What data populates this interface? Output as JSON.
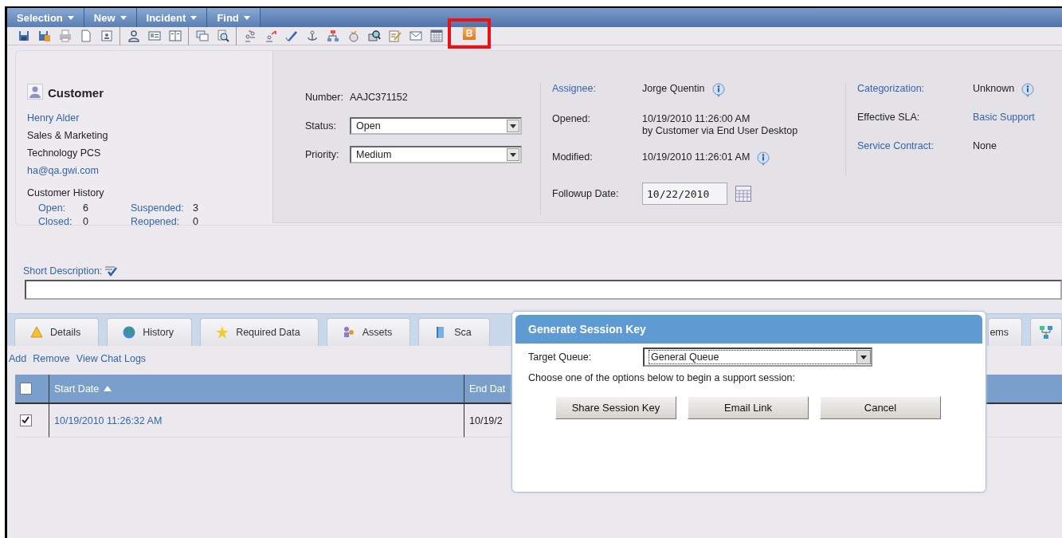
{
  "menu": [
    {
      "label": "Selection"
    },
    {
      "label": "New"
    },
    {
      "label": "Incident"
    },
    {
      "label": "Find"
    }
  ],
  "toolbar": {
    "groups": [
      [
        {
          "highlighted": false
        },
        {
          "highlighted": false
        },
        {
          "highlighted": false
        },
        {
          "highlighted": false
        },
        {
          "highlighted": false
        }
      ],
      [
        {
          "highlighted": false
        },
        {
          "highlighted": false
        },
        {
          "highlighted": false
        }
      ],
      [
        {
          "highlighted": false
        },
        {
          "highlighted": false
        }
      ],
      [
        {
          "highlighted": false
        },
        {
          "highlighted": false
        },
        {
          "highlighted": false
        },
        {
          "highlighted": false
        },
        {
          "highlighted": false
        },
        {
          "highlighted": false
        },
        {
          "highlighted": false
        },
        {
          "highlighted": false
        },
        {
          "highlighted": false
        },
        {
          "highlighted": false
        },
        {
          "highlighted": true,
          "label": "B"
        }
      ]
    ]
  },
  "customer": {
    "title": "Customer",
    "name": "Henry Alder",
    "department": "Sales & Marketing",
    "company": "Technology PCS",
    "email": "ha@qa.gwi.com",
    "history_title": "Customer History",
    "history": [
      {
        "label": "Open:",
        "value": "6"
      },
      {
        "label": "Suspended:",
        "value": "3"
      },
      {
        "label": "Closed:",
        "value": "0"
      },
      {
        "label": "Reopened:",
        "value": "0"
      }
    ]
  },
  "incident": {
    "number_label": "Number:",
    "number": "AAJC371152",
    "status_label": "Status:",
    "status": "Open",
    "priority_label": "Priority:",
    "priority": "Medium"
  },
  "details": [
    {
      "kind": "text",
      "label": "Assignee:",
      "label_link": true,
      "lines": [
        "Jorge Quentin"
      ],
      "info": true
    },
    {
      "kind": "text",
      "label": "Opened:",
      "label_link": false,
      "lines": [
        "10/19/2010 11:26:00 AM",
        "by Customer via End User Desktop"
      ],
      "info": false
    },
    {
      "kind": "text",
      "label": "Modified:",
      "label_link": false,
      "lines": [
        "10/19/2010 11:26:01 AM"
      ],
      "info": true
    },
    {
      "kind": "date",
      "label": "Followup Date:",
      "label_link": false,
      "value": "10/22/2010"
    }
  ],
  "classification": [
    {
      "label": "Categorization:",
      "label_link": true,
      "value": "Unknown",
      "value_link": false,
      "info": true
    },
    {
      "label": "Effective SLA:",
      "label_link": false,
      "value": "Basic Support",
      "value_link": true,
      "info": false
    },
    {
      "label": "Service Contract:",
      "label_link": true,
      "value": "None",
      "value_link": false,
      "info": false
    }
  ],
  "short_description": {
    "label": "Short Description:"
  },
  "tabs": [
    {
      "label": "Details",
      "selected": false
    },
    {
      "label": "History",
      "selected": false
    },
    {
      "label": "Required Data",
      "selected": false
    },
    {
      "label": "Assets",
      "selected": false
    },
    {
      "label": "Sca",
      "selected": false
    },
    {
      "label": "ems",
      "selected": false
    },
    {
      "selected": false
    }
  ],
  "actions": [
    {
      "label": "Add"
    },
    {
      "label": "Remove"
    },
    {
      "label": "View Chat Logs"
    }
  ],
  "table": {
    "select_all": {
      "checked": false
    },
    "columns": [
      {
        "label": "Start Date",
        "sorted": true
      },
      {
        "label": "End Dat",
        "sorted": false
      }
    ],
    "rows": [
      {
        "checked": true,
        "cells": [
          "10/19/2010 11:26:32 AM",
          "10/19/2"
        ]
      }
    ]
  },
  "dialog": {
    "title": "Generate Session Key",
    "queue_label": "Target Queue:",
    "queue": "General Queue",
    "message": "Choose one of the options below to begin a support session:",
    "buttons": [
      {
        "label": "Share Session Key"
      },
      {
        "label": "Email Link"
      },
      {
        "label": "Cancel"
      }
    ]
  }
}
